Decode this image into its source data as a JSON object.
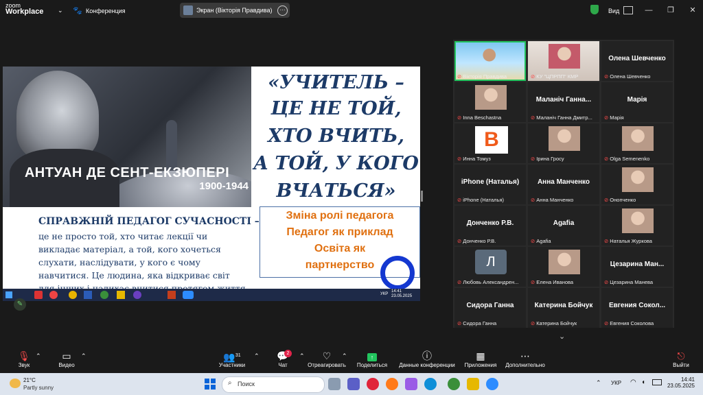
{
  "topbar": {
    "logo_line1": "zoom",
    "logo_line2": "Workplace",
    "meeting_label": "Конференция",
    "share_label": "Экран (Вікторія Правдива)",
    "view_label": "Вид"
  },
  "slide": {
    "author_name": "АНТУАН ДЕ СЕНТ-ЕКЗЮПЕРІ",
    "author_years": "1900-1944",
    "quote_lines": [
      "«УЧИТЕЛЬ –",
      "ЦЕ НЕ ТОЙ,",
      "ХТО ВЧИТЬ,",
      "А ТОЙ, У КОГО",
      "ВЧАТЬСЯ»"
    ],
    "roles": [
      "Зміна ролі педагога",
      "Педагог як приклад",
      "Освіта як",
      "партнерство"
    ],
    "heading": "СПРАВЖНІЙ ПЕДАГОГ СУЧАСНОСТІ –",
    "body_lines": [
      "це не просто той, хто читає лекції чи",
      "викладає матеріал, а той, кого хочеться",
      "слухати, наслідувати, у кого є чому",
      "навчитися. Це людина, яка відкриває світ",
      "для інших і надихає вчитися протягом життя"
    ],
    "inner_clock_time": "14:41",
    "inner_clock_date": "23.05.2025",
    "inner_lang": "УКР"
  },
  "participants": [
    {
      "name": "Вікторія Правдива",
      "big": "",
      "type": "beach"
    },
    {
      "name": "КУ \"ЦПРПП\" КМР",
      "big": "",
      "type": "woman"
    },
    {
      "name": "Олена Шевченко",
      "big": "Олена Шевченко",
      "type": "text"
    },
    {
      "name": "Inna Beschastna",
      "big": "",
      "type": "pic"
    },
    {
      "name": "Маланіч Ганна Дмитр...",
      "big": "Маланіч Ганна...",
      "type": "text"
    },
    {
      "name": "Марія",
      "big": "Марія",
      "type": "text"
    },
    {
      "name": "Инна Томуз",
      "big": "",
      "type": "bicon"
    },
    {
      "name": "Ірина Гросу",
      "big": "",
      "type": "pic"
    },
    {
      "name": "Olga Semenenko",
      "big": "",
      "type": "pic"
    },
    {
      "name": "iPhone (Наталья)",
      "big": "iPhone (Наталья)",
      "type": "text"
    },
    {
      "name": "Анна Манченко",
      "big": "Анна Манченко",
      "type": "text"
    },
    {
      "name": "Онопченко",
      "big": "",
      "type": "pic"
    },
    {
      "name": "Донченко Р.В.",
      "big": "Донченко Р.В.",
      "type": "text"
    },
    {
      "name": "Agafia",
      "big": "Agafia",
      "type": "text"
    },
    {
      "name": "Наталья Журкова",
      "big": "",
      "type": "pic"
    },
    {
      "name": "Любовь Александрен...",
      "big": "",
      "type": "licon"
    },
    {
      "name": "Елена Иванова",
      "big": "",
      "type": "pic"
    },
    {
      "name": "Цезарина Манева",
      "big": "Цезарина Ман...",
      "type": "text"
    },
    {
      "name": "Сидора Ганна",
      "big": "Сидора Ганна",
      "type": "text"
    },
    {
      "name": "Катерина Бойчук",
      "big": "Катерина Бойчук",
      "type": "text"
    },
    {
      "name": "Евгения Соколова",
      "big": "Евгения Сокол...",
      "type": "text"
    }
  ],
  "licon_letter": "Л",
  "toolbar": {
    "audio": "Звук",
    "video": "Видео",
    "participants": "Участники",
    "participants_count": "31",
    "chat": "Чат",
    "chat_badge": "2",
    "react": "Отреагировать",
    "share": "Поделиться",
    "info": "Данные конференции",
    "apps": "Приложения",
    "more": "Дополнительно",
    "leave": "Выйти"
  },
  "taskbar": {
    "temp": "21°C",
    "weather": "Partly sunny",
    "search": "Поиск",
    "lang": "УКР",
    "time": "14:41",
    "date": "23.05.2025"
  }
}
